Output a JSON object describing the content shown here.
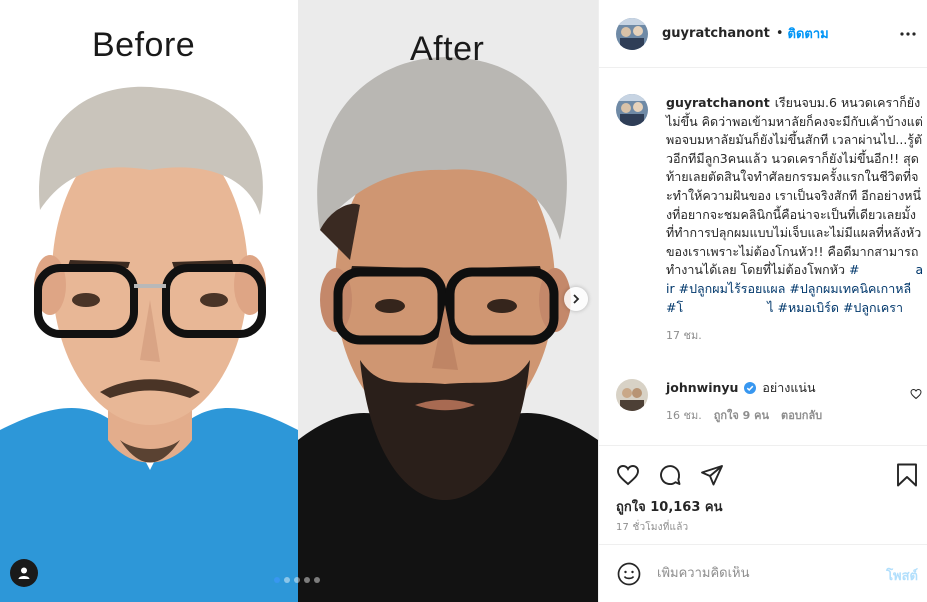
{
  "media": {
    "label_before": "Before",
    "label_after": "After",
    "icons": {
      "next": "chevron-right-icon",
      "user_tags": "user-icon"
    },
    "carousel": {
      "slide_count": 5,
      "active_index": 0
    },
    "colors": {
      "left_background": "#ffffff",
      "left_scrub": "#2d97d8",
      "right_background": "#ededed",
      "right_shirt": "#121212"
    }
  },
  "header": {
    "username": "guyratchanont",
    "separator": "•",
    "follow_label": "ติดตาม",
    "more_icon": "more-horizontal-icon"
  },
  "caption": {
    "username": "guyratchanont",
    "text": "เรียนจบม.6 หนวดเคราก็ยังไม่ขึ้น คิดว่าพอเข้ามหาลัยก็คงจะมีกับเค้าบ้างแต่พอจบมหาลัยมันก็ยังไม่ขึ้นสักที เวลาผ่านไป...รู้ตัวอีกทีมีลูก3คนแล้ว นวดเคราก็ยังไม่ขึ้นอีก!! สุดท้ายเลยตัดสินใจทำศัลยกรรมครั้งแรกในชีวิตที่จะทำให้ความฝันของ เราเป็นจริงสักที อีกอย่างหนึ่งที่อยากจะชมคลินิกนี้คือน่าจะเป็นที่เดียวเลยมั้งที่ทำการปลุกผมแบบไม่เจ็บและไม่มีแผลที่หลังหัวของเราเพราะไม่ต้องโกนหัว!! คือดีมากสามารถทำงานได้เลย โดยที่ไม่ต้องโพกหัว",
    "hashtags": [
      "#ปลูกผมไร้รอยแผล",
      "#ปลูกผมเทคนิคเกาหลี",
      "#หมอเบิร์ด",
      "#ปลูกเครา"
    ],
    "tags_partial": [
      "#",
      "air",
      "#โ",
      "ไ"
    ],
    "time": "17 ชม."
  },
  "comment": {
    "username": "johnwinyu",
    "text": "อย่างแน่น",
    "time": "16 ชม.",
    "likes": "ถูกใจ 9 คน",
    "reply": "ตอบกลับ",
    "verified_icon": "verified-badge-icon",
    "like_icon": "heart-outline-icon"
  },
  "actions": {
    "like_icon": "heart-outline-icon",
    "comment_icon": "comment-bubble-icon",
    "share_icon": "paper-plane-icon",
    "save_icon": "bookmark-icon",
    "likes_text": "ถูกใจ 10,163 คน",
    "time_ago": "17 ชั่วโมงที่แล้ว"
  },
  "add_comment": {
    "emoji_icon": "smiley-icon",
    "placeholder": "เพิ่มความคิดเห็น",
    "post_label": "โพสต์"
  },
  "colors": {
    "link_blue": "#0095f6",
    "hashtag": "#00376b",
    "muted_text": "#8e8e8e",
    "post_disabled": "#b2dffc",
    "verified": "#3897f0"
  }
}
